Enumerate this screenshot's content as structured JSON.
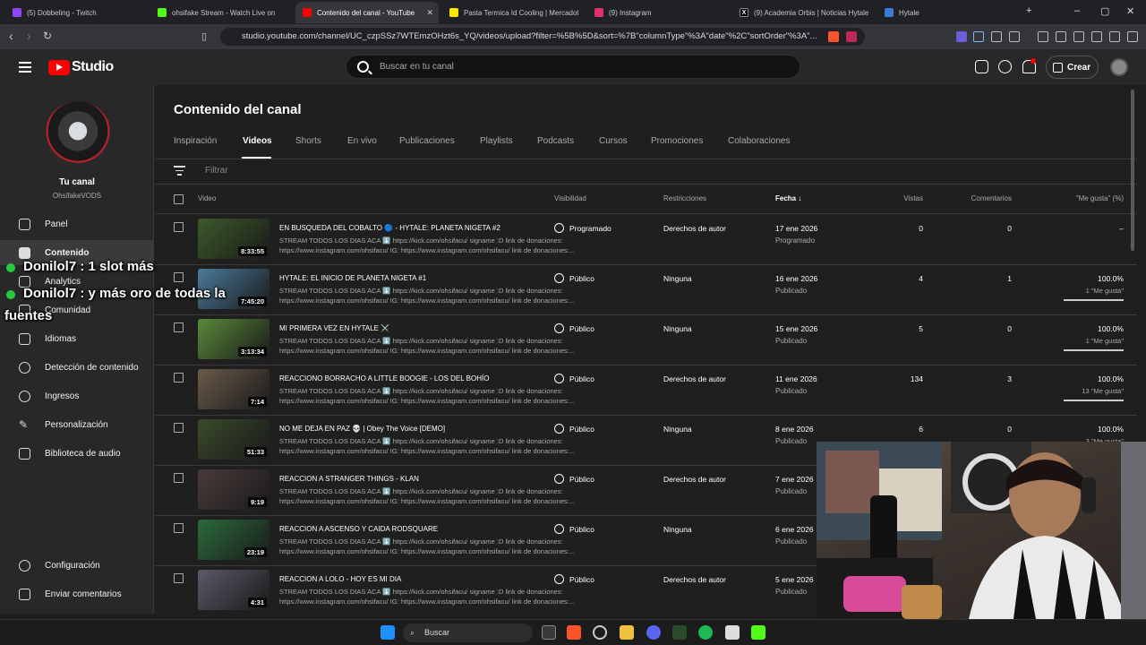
{
  "browser": {
    "tabs": [
      {
        "label": "(5) Dobbeling - Twitch",
        "color": "#9146ff"
      },
      {
        "label": "ohsifake Stream - Watch Live on",
        "color": "#53fc18"
      },
      {
        "label": "Contenido del canal - YouTube",
        "color": "#ff0000"
      },
      {
        "label": "Pasta Termica Id Cooling | Mercadol",
        "color": "#ffe600"
      },
      {
        "label": "(9) Instagram",
        "color": "#e1306c"
      },
      {
        "label": "(9) Academia Orbis | Noticias Hytale",
        "color": "#000000"
      },
      {
        "label": "Hytale",
        "color": "#3a7bd5"
      }
    ],
    "url": "studio.youtube.com/channel/UC_czpSSz7WTEmzOHzt6s_YQ/videos/upload?filter=%5B%5D&sort=%7B\"columnType\"%3A\"date\"%2C\"sortOrder\"%3A\"..."
  },
  "header": {
    "logo": "Studio",
    "search_placeholder": "Buscar en tu canal",
    "create_label": "Crear"
  },
  "sidebar": {
    "channel_title": "Tu canal",
    "channel_name": "OhsifakeVODS",
    "items": [
      {
        "label": "Panel",
        "icon": "dashboard-icon"
      },
      {
        "label": "Contenido",
        "icon": "content-icon"
      },
      {
        "label": "Analytics",
        "icon": "analytics-icon"
      },
      {
        "label": "Comunidad",
        "icon": "community-icon"
      },
      {
        "label": "Idiomas",
        "icon": "subtitles-icon"
      },
      {
        "label": "Detección de contenido",
        "icon": "copyright-icon"
      },
      {
        "label": "Ingresos",
        "icon": "money-icon"
      },
      {
        "label": "Personalización",
        "icon": "customization-icon"
      },
      {
        "label": "Biblioteca de audio",
        "icon": "audio-library-icon"
      }
    ],
    "bottom": [
      {
        "label": "Configuración",
        "icon": "gear-icon"
      },
      {
        "label": "Enviar comentarios",
        "icon": "feedback-icon"
      }
    ]
  },
  "main": {
    "title": "Contenido del canal",
    "tabs": [
      "Inspiración",
      "Videos",
      "Shorts",
      "En vivo",
      "Publicaciones",
      "Playlists",
      "Podcasts",
      "Cursos",
      "Promociones",
      "Colaboraciones"
    ],
    "filter_placeholder": "Filtrar",
    "columns": {
      "video": "Video",
      "visibility": "Visibilidad",
      "restrictions": "Restricciones",
      "date": "Fecha",
      "views": "Vistas",
      "comments": "Comentarios",
      "likes": "\"Me gusta\" (%)"
    },
    "videos": [
      {
        "title": "EN BUSQUEDA DEL COBALTO 🔵 - HYTALE: PLANETA NIGETA #2",
        "desc1": "STREAM TODOS LOS DIAS ACA ⬇️ https://kick.com/ohsifacu/ signame :D link de donaciones:",
        "desc2": "https://www.instagram.com/ohsifacu/ IG: https://www.instagram.com/ohsifacu/ link de donaciones:...",
        "duration": "8:33:55",
        "visibility": "Programado",
        "restriction": "Derechos de autor",
        "date": "17 ene 2026",
        "date_status": "Programado",
        "views": "0",
        "comments": "0",
        "likes": "–",
        "likes_sub": "",
        "likes_pct": 0,
        "thumb": "#3c5a2a"
      },
      {
        "title": "HYTALE: EL INICIO DE PLANETA NIGETA #1",
        "desc1": "STREAM TODOS LOS DIAS ACA ⬇️ https://kick.com/ohsifacu/ signame :D link de donaciones:",
        "desc2": "https://www.instagram.com/ohsifacu/ IG: https://www.instagram.com/ohsifacu/ link de donaciones:...",
        "duration": "7:45:20",
        "visibility": "Público",
        "restriction": "Ninguna",
        "date": "16 ene 2026",
        "date_status": "Publicado",
        "views": "4",
        "comments": "1",
        "likes": "100.0%",
        "likes_sub": "1 \"Me gusta\"",
        "likes_pct": 100,
        "thumb": "#4a7a9a"
      },
      {
        "title": "MI PRIMERA VEZ EN HYTALE ⚔️",
        "desc1": "STREAM TODOS LOS DIAS ACA ⬇️ https://kick.com/ohsifacu/ signame :D link de donaciones:",
        "desc2": "https://www.instagram.com/ohsifacu/ IG: https://www.instagram.com/ohsifacu/ link de donaciones:...",
        "duration": "3:13:34",
        "visibility": "Público",
        "restriction": "Ninguna",
        "date": "15 ene 2026",
        "date_status": "Publicado",
        "views": "5",
        "comments": "0",
        "likes": "100.0%",
        "likes_sub": "1 \"Me gusta\"",
        "likes_pct": 100,
        "thumb": "#5a8a3a"
      },
      {
        "title": "REACCIONO BORRACHO A LITTLE BOOGIE - LOS DEL BOHÍO",
        "desc1": "STREAM TODOS LOS DIAS ACA ⬇️ https://kick.com/ohsifacu/ signame :D link de donaciones:",
        "desc2": "https://www.instagram.com/ohsifacu/ IG: https://www.instagram.com/ohsifacu/ link de donaciones:...",
        "duration": "7:14",
        "visibility": "Público",
        "restriction": "Derechos de autor",
        "date": "11 ene 2026",
        "date_status": "Publicado",
        "views": "134",
        "comments": "3",
        "likes": "100.0%",
        "likes_sub": "13 \"Me gusta\"",
        "likes_pct": 100,
        "thumb": "#6a5a4a"
      },
      {
        "title": "NO ME DEJA EN PAZ 💀 | Obey The Voice [DEMO]",
        "desc1": "STREAM TODOS LOS DIAS ACA ⬇️ https://kick.com/ohsifacu/ signame :D link de donaciones:",
        "desc2": "https://www.instagram.com/ohsifacu/ IG: https://www.instagram.com/ohsifacu/ link de donaciones:...",
        "duration": "51:33",
        "visibility": "Público",
        "restriction": "Ninguna",
        "date": "8 ene 2026",
        "date_status": "Publicado",
        "views": "6",
        "comments": "0",
        "likes": "100.0%",
        "likes_sub": "3 \"Me gusta\"",
        "likes_pct": 100,
        "thumb": "#3a4a2a"
      },
      {
        "title": "REACCION A STRANGER THINGS - KLAN",
        "desc1": "STREAM TODOS LOS DIAS ACA ⬇️ https://kick.com/ohsifacu/ signame :D link de donaciones:",
        "desc2": "https://www.instagram.com/ohsifacu/ IG: https://www.instagram.com/ohsifacu/ link de donaciones:...",
        "duration": "9:19",
        "visibility": "Público",
        "restriction": "Derechos de autor",
        "date": "7 ene 2026",
        "date_status": "Publicado",
        "views": "",
        "comments": "",
        "likes": "",
        "likes_sub": "",
        "likes_pct": 0,
        "thumb": "#4a3a3a"
      },
      {
        "title": "REACCION A ASCENSO Y CAIDA RODSQUARE",
        "desc1": "STREAM TODOS LOS DIAS ACA ⬇️ https://kick.com/ohsifacu/ signame :D link de donaciones:",
        "desc2": "https://www.instagram.com/ohsifacu/ IG: https://www.instagram.com/ohsifacu/ link de donaciones:...",
        "duration": "23:19",
        "visibility": "Público",
        "restriction": "Ninguna",
        "date": "6 ene 2026",
        "date_status": "Publicado",
        "views": "",
        "comments": "",
        "likes": "",
        "likes_sub": "",
        "likes_pct": 0,
        "thumb": "#2a6a3a"
      },
      {
        "title": "REACCION A LOLO - HOY ES MI DIA",
        "desc1": "STREAM TODOS LOS DIAS ACA ⬇️ https://kick.com/ohsifacu/ signame :D link de donaciones:",
        "desc2": "https://www.instagram.com/ohsifacu/ IG: https://www.instagram.com/ohsifacu/ link de donaciones:...",
        "duration": "4:31",
        "visibility": "Público",
        "restriction": "Derechos de autor",
        "date": "5 ene 2026",
        "date_status": "Publicado",
        "views": "",
        "comments": "",
        "likes": "",
        "likes_sub": "",
        "likes_pct": 0,
        "thumb": "#5a5a6a"
      }
    ]
  },
  "overlay_chat": [
    {
      "user": "Donilol7",
      "text": " : 1 slot más"
    },
    {
      "user": "Donilol7",
      "text": " : y más oro de todas la"
    },
    {
      "user": "",
      "text": "fuentes"
    }
  ],
  "taskbar": {
    "search_label": "Buscar"
  }
}
